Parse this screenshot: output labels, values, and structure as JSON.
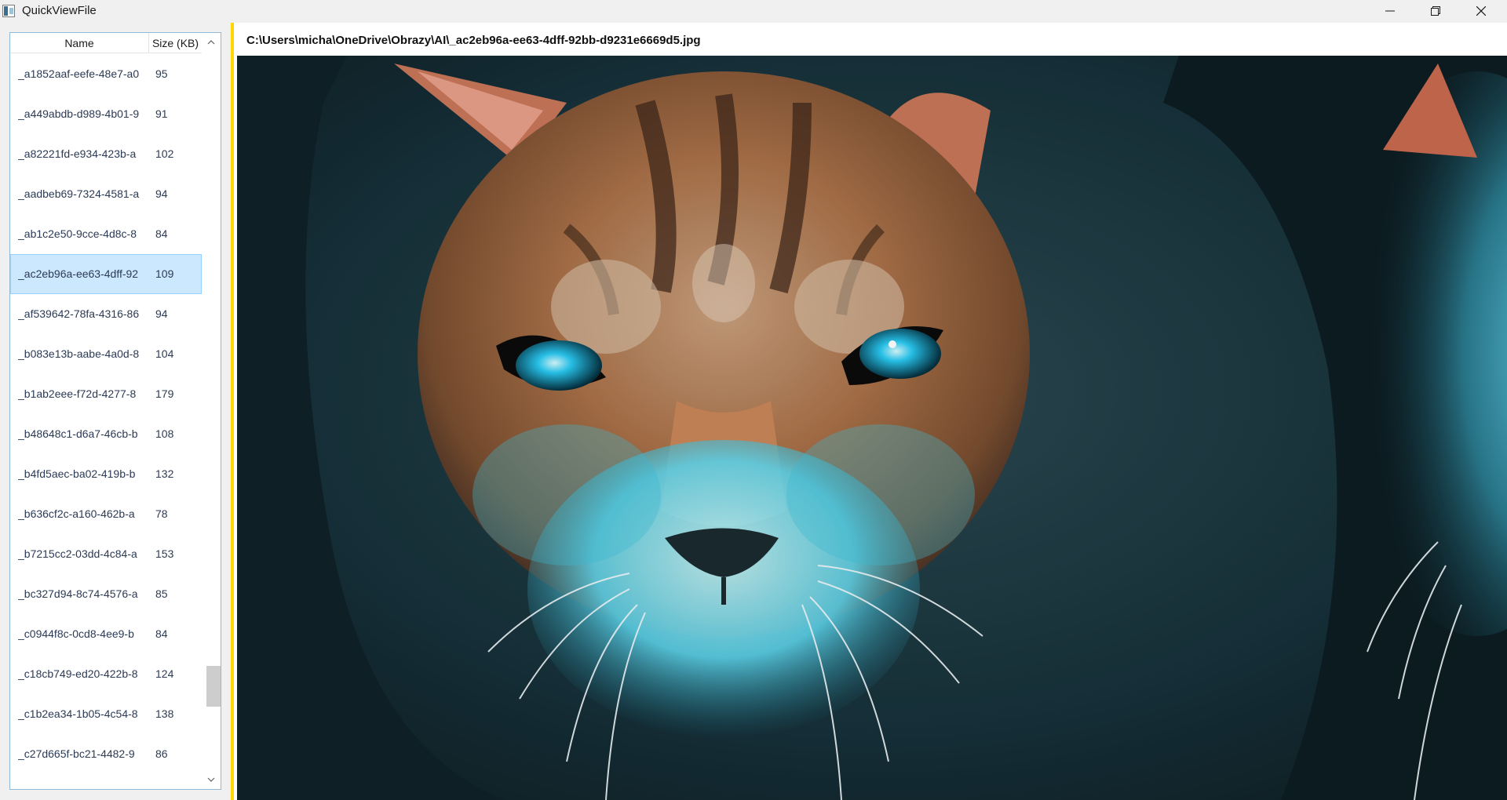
{
  "window": {
    "title": "QuickViewFile"
  },
  "file_list": {
    "columns": {
      "name": "Name",
      "size": "Size (KB)"
    },
    "rows": [
      {
        "name": "_a1852aaf-eefe-48e7-a0",
        "size": "95"
      },
      {
        "name": "_a449abdb-d989-4b01-9",
        "size": "91"
      },
      {
        "name": "_a82221fd-e934-423b-a",
        "size": "102"
      },
      {
        "name": "_aadbeb69-7324-4581-a",
        "size": "94"
      },
      {
        "name": "_ab1c2e50-9cce-4d8c-8",
        "size": "84"
      },
      {
        "name": "_ac2eb96a-ee63-4dff-92",
        "size": "109",
        "selected": true
      },
      {
        "name": "_af539642-78fa-4316-86",
        "size": "94"
      },
      {
        "name": "_b083e13b-aabe-4a0d-8",
        "size": "104"
      },
      {
        "name": "_b1ab2eee-f72d-4277-8",
        "size": "179"
      },
      {
        "name": "_b48648c1-d6a7-46cb-b",
        "size": "108"
      },
      {
        "name": "_b4fd5aec-ba02-419b-b",
        "size": "132"
      },
      {
        "name": "_b636cf2c-a160-462b-a",
        "size": "78"
      },
      {
        "name": "_b7215cc2-03dd-4c84-a",
        "size": "153"
      },
      {
        "name": "_bc327d94-8c74-4576-a",
        "size": "85"
      },
      {
        "name": "_c0944f8c-0cd8-4ee9-b",
        "size": "84"
      },
      {
        "name": "_c18cb749-ed20-422b-8",
        "size": "124"
      },
      {
        "name": "_c1b2ea34-1b05-4c54-8",
        "size": "138"
      },
      {
        "name": "_c27d665f-bc21-4482-9",
        "size": "86"
      }
    ]
  },
  "viewer": {
    "path": "C:\\Users\\micha\\OneDrive\\Obrazy\\AI\\_ac2eb96a-ee63-4dff-92bb-d9231e6669d5.jpg"
  },
  "colors": {
    "splitter": "#ffd800",
    "selection": "#cce8ff",
    "eye_glow": "#29c9f2"
  }
}
